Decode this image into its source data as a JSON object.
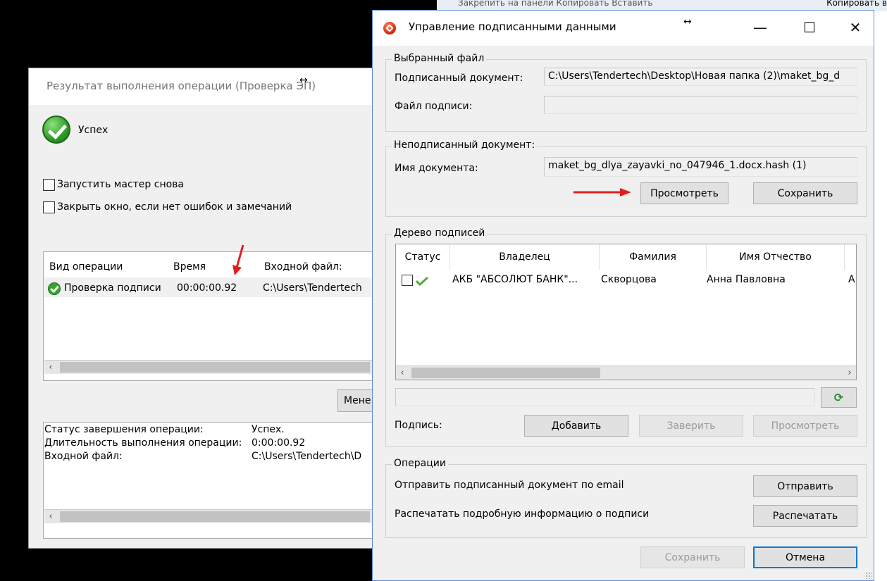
{
  "background": {
    "top_strip_left": "Закрепить на панели  Копировать  Вставить",
    "top_strip_right": "Копировать в"
  },
  "result_dialog": {
    "title": "Результат выполнения операции (Проверка ЭП)",
    "success_label": "Успех",
    "restart_wizard_label": "Запустить мастер снова",
    "close_window_label": "Закрыть окно, если нет ошибок и замечаний",
    "operations_table": {
      "headers": [
        "Вид операции",
        "Время",
        "Входной файл:"
      ],
      "rows": [
        {
          "type": "Проверка подписи",
          "time": "00:00:00.92",
          "file": "C:\\Users\\Tendertech"
        }
      ]
    },
    "manager_button": "Мене",
    "status": {
      "completion_label": "Статус завершения операции:",
      "completion_value": "Успех.",
      "duration_label": "Длительность выполнения операции:",
      "duration_value": "0:00:00.92",
      "input_label": "Входной файл:",
      "input_value": "C:\\Users\\Tendertech\\D"
    }
  },
  "main_dialog": {
    "title": "Управление подписанными данными",
    "window_controls": {
      "minimize": "—",
      "maximize": "☐",
      "close": "✕"
    },
    "selected_file": {
      "group_title": "Выбранный файл",
      "signed_doc_label": "Подписанный документ:",
      "signed_doc_value": "C:\\Users\\Tendertech\\Desktop\\Новая папка (2)\\maket_bg_d",
      "signature_file_label": "Файл подписи:",
      "signature_file_value": ""
    },
    "unsigned_doc": {
      "group_title": "Неподписанный документ:",
      "name_label": "Имя документа:",
      "name_value": "maket_bg_dlya_zayavki_no_047946_1.docx.hash (1)",
      "view_button": "Просмотреть",
      "save_button": "Сохранить"
    },
    "signature_tree": {
      "group_title": "Дерево подписей",
      "headers": [
        "Статус",
        "Владелец",
        "Фамилия",
        "Имя Отчество"
      ],
      "rows": [
        {
          "owner": "АКБ \"АБСОЛЮТ БАНК\"...",
          "surname": "Скворцова",
          "name": "Анна Павловна",
          "extra": "А"
        }
      ],
      "signature_label": "Подпись:",
      "add_button": "Добавить",
      "certify_button": "Заверить",
      "view_button": "Просмотреть"
    },
    "operations": {
      "group_title": "Операции",
      "email_label": "Отправить подписанный документ по email",
      "send_button": "Отправить",
      "print_label": "Распечатать подробную информацию о подписи",
      "print_button": "Распечатать"
    },
    "footer": {
      "save_button": "Сохранить",
      "cancel_button": "Отмена"
    }
  },
  "colors": {
    "accent": "#0078d7",
    "success": "#2f9b2a",
    "arrow": "#e02020"
  }
}
